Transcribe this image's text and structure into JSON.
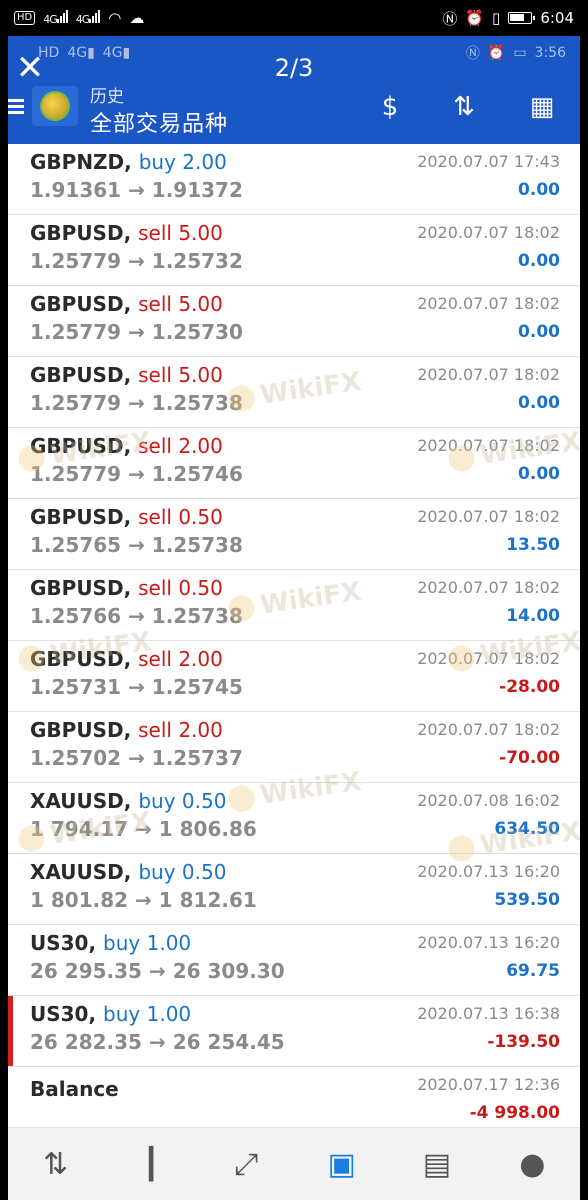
{
  "system_status": {
    "time": "6:04",
    "left_icons": [
      "hd-icon",
      "signal-4g-icon",
      "signal-4g-icon",
      "wifi-icon",
      "cloud-icon"
    ],
    "right_icons": [
      "nfc-icon",
      "alarm-icon",
      "vibrate-icon",
      "battery-icon"
    ]
  },
  "viewer": {
    "close_glyph": "✕",
    "pager": "2/3",
    "inner_time": "3:56"
  },
  "header": {
    "subtitle": "历史",
    "title": "全部交易品种",
    "icons": [
      "currency-exchange-icon",
      "sort-icon",
      "calendar-icon"
    ]
  },
  "trades": [
    {
      "symbol": "GBPNZD,",
      "side": "buy",
      "side_label": "buy 2.00",
      "open": "1.91361",
      "close": "1.91372",
      "time": "2020.07.07 17:43",
      "pl": "0.00",
      "sign": "pos"
    },
    {
      "symbol": "GBPUSD,",
      "side": "sell",
      "side_label": "sell 5.00",
      "open": "1.25779",
      "close": "1.25732",
      "time": "2020.07.07 18:02",
      "pl": "0.00",
      "sign": "pos"
    },
    {
      "symbol": "GBPUSD,",
      "side": "sell",
      "side_label": "sell 5.00",
      "open": "1.25779",
      "close": "1.25730",
      "time": "2020.07.07 18:02",
      "pl": "0.00",
      "sign": "pos"
    },
    {
      "symbol": "GBPUSD,",
      "side": "sell",
      "side_label": "sell 5.00",
      "open": "1.25779",
      "close": "1.25738",
      "time": "2020.07.07 18:02",
      "pl": "0.00",
      "sign": "pos"
    },
    {
      "symbol": "GBPUSD,",
      "side": "sell",
      "side_label": "sell 2.00",
      "open": "1.25779",
      "close": "1.25746",
      "time": "2020.07.07 18:02",
      "pl": "0.00",
      "sign": "pos"
    },
    {
      "symbol": "GBPUSD,",
      "side": "sell",
      "side_label": "sell 0.50",
      "open": "1.25765",
      "close": "1.25738",
      "time": "2020.07.07 18:02",
      "pl": "13.50",
      "sign": "pos"
    },
    {
      "symbol": "GBPUSD,",
      "side": "sell",
      "side_label": "sell 0.50",
      "open": "1.25766",
      "close": "1.25738",
      "time": "2020.07.07 18:02",
      "pl": "14.00",
      "sign": "pos"
    },
    {
      "symbol": "GBPUSD,",
      "side": "sell",
      "side_label": "sell 2.00",
      "open": "1.25731",
      "close": "1.25745",
      "time": "2020.07.07 18:02",
      "pl": "-28.00",
      "sign": "neg"
    },
    {
      "symbol": "GBPUSD,",
      "side": "sell",
      "side_label": "sell 2.00",
      "open": "1.25702",
      "close": "1.25737",
      "time": "2020.07.07 18:02",
      "pl": "-70.00",
      "sign": "neg"
    },
    {
      "symbol": "XAUUSD,",
      "side": "buy",
      "side_label": "buy 0.50",
      "open": "1 794.17",
      "close": "1 806.86",
      "time": "2020.07.08 16:02",
      "pl": "634.50",
      "sign": "pos"
    },
    {
      "symbol": "XAUUSD,",
      "side": "buy",
      "side_label": "buy 0.50",
      "open": "1 801.82",
      "close": "1 812.61",
      "time": "2020.07.13 16:20",
      "pl": "539.50",
      "sign": "pos"
    },
    {
      "symbol": "US30,",
      "side": "buy",
      "side_label": "buy 1.00",
      "open": "26 295.35",
      "close": "26 309.30",
      "time": "2020.07.13 16:20",
      "pl": "69.75",
      "sign": "pos"
    },
    {
      "symbol": "US30,",
      "side": "buy",
      "side_label": "buy 1.00",
      "open": "26 282.35",
      "close": "26 254.45",
      "time": "2020.07.13 16:38",
      "pl": "-139.50",
      "sign": "neg",
      "active": true
    }
  ],
  "balance": {
    "label": "Balance",
    "time": "2020.07.17 12:36",
    "amount": "-4 998.00"
  },
  "arrow": "→",
  "watermark": "WikiFX",
  "bottom_nav": [
    {
      "name": "quotes-tab-icon",
      "glyph": "⇅"
    },
    {
      "name": "chart-tab-icon",
      "glyph": "┃"
    },
    {
      "name": "trade-tab-icon",
      "glyph": "⤢"
    },
    {
      "name": "history-tab-icon",
      "glyph": "▣",
      "active": true
    },
    {
      "name": "news-tab-icon",
      "glyph": "▤"
    },
    {
      "name": "chat-tab-icon",
      "glyph": "●"
    }
  ]
}
